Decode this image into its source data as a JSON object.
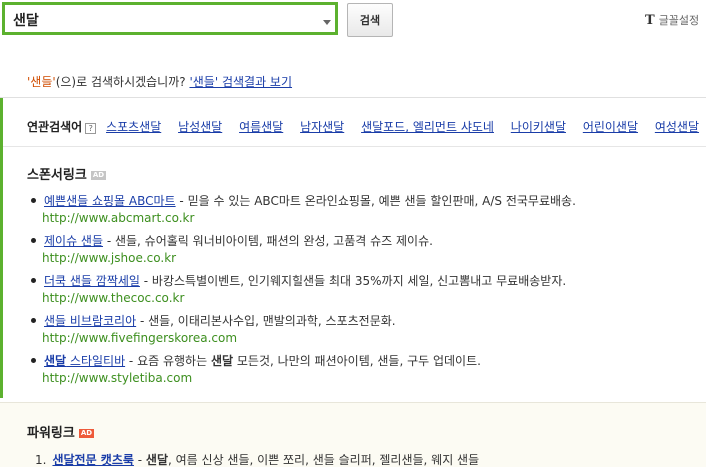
{
  "search": {
    "value": "샌달",
    "button_label": "검색"
  },
  "font_setting": {
    "icon": "T",
    "label": "글꼴설정"
  },
  "suggest": {
    "term": "'샌들'",
    "text": "(으)로 검색하시겠습니까?",
    "link": "'샌들' 검색결과 보기"
  },
  "related": {
    "title": "연관검색어",
    "help": "?",
    "items": [
      "스포츠샌달",
      "남성샌달",
      "여름샌달",
      "남자샌달",
      "샌달포드, 엘리먼트 샤도네",
      "나이키샌달",
      "어린이샌달",
      "여성샌달"
    ]
  },
  "sponsor": {
    "title": "스폰서링크",
    "badge": "AD",
    "ads": [
      {
        "title": "예쁜샌들 쇼핑몰 ABC마트",
        "desc": " - 믿을 수 있는 ABC마트 온라인쇼핑몰, 예쁜 샌들 할인판매, A/S 전국무료배송.",
        "url": "http://www.abcmart.co.kr"
      },
      {
        "title": "제이슈 샌들",
        "desc": " - 샌들, 슈어홀릭 워너비아이템, 패션의 완성, 고품격 슈즈 제이슈.",
        "url": "http://www.jshoe.co.kr"
      },
      {
        "title": "더쿡 샌들 깜짝세일",
        "desc": " - 바캉스특별이벤트, 인기웨지힐샌들 최대 35%까지 세일, 신고뽐내고 무료배송받자.",
        "url": "http://www.thecoc.co.kr"
      },
      {
        "title": "샌들 비브람코리아",
        "desc": " - 샌들, 이태리본사수입, 맨발의과학, 스포츠전문화.",
        "url": "http://www.fivefingerskorea.com"
      },
      {
        "title_bold": "샌달",
        "title_rest": " 스타일티바",
        "desc_a": " - 요즘 유행하는 ",
        "desc_bold": "샌달",
        "desc_b": " 모든것, 나만의 패션아이템, 샌들, 구두 업데이트.",
        "url": "http://www.styletiba.com"
      }
    ]
  },
  "power": {
    "title": "파워링크",
    "badge": "AD",
    "item": {
      "num": "1.",
      "title_bold": "샌달",
      "title_rest": "전문 캣츠룩",
      "desc_a": " - ",
      "desc_bold": "샌달",
      "desc_b": ", 여름 신상 샌들, 이쁜 쪼리, 샌들 슬리퍼, 젤리샌들, 웨지 샌들"
    }
  }
}
